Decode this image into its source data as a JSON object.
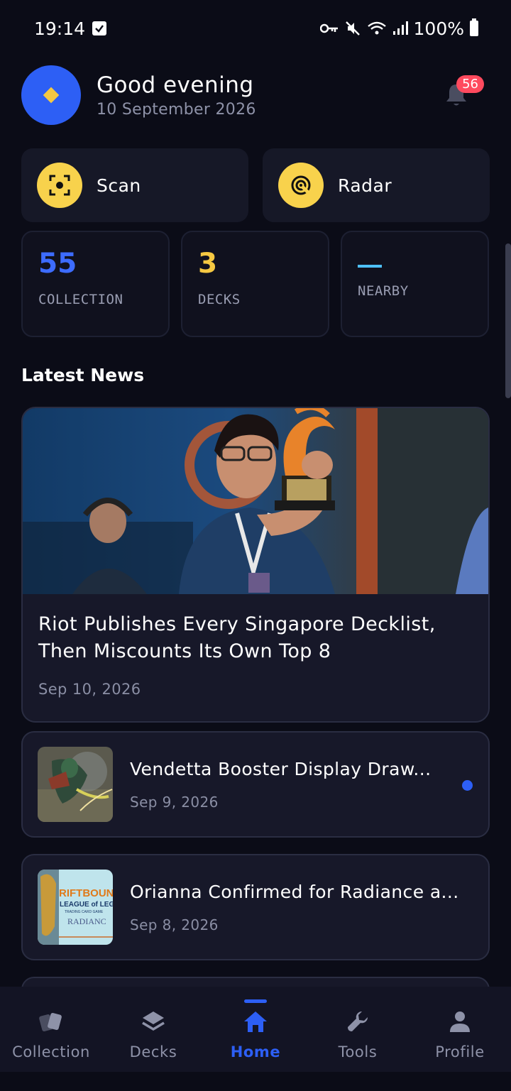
{
  "status_bar": {
    "time": "19:14",
    "battery": "100%"
  },
  "header": {
    "greeting": "Good evening",
    "date": "10 September 2026",
    "notification_count": "56"
  },
  "actions": [
    {
      "label": "Scan",
      "icon": "scan-icon"
    },
    {
      "label": "Radar",
      "icon": "radar-icon"
    }
  ],
  "stats": [
    {
      "value": "55",
      "label": "COLLECTION",
      "color": "#3d6cff"
    },
    {
      "value": "3",
      "label": "DECKS",
      "color": "#f5c842"
    },
    {
      "value": "",
      "label": "NEARBY",
      "color": "#4ec0ff"
    }
  ],
  "news": {
    "section_title": "Latest News",
    "featured": {
      "title": "Riot Publishes Every Singapore Decklist, Then Miscounts Its Own Top 8",
      "date": "Sep 10, 2026"
    },
    "items": [
      {
        "title": "Vendetta Booster Display Draw...",
        "date": "Sep 9, 2026",
        "unread": true
      },
      {
        "title": "Orianna Confirmed for Radiance a...",
        "date": "Sep 8, 2026",
        "unread": false
      }
    ],
    "thumb_logo_text": [
      "RIFTBOUN",
      "LEAGUE of LEGEN",
      "TRADING CARD GAME",
      "RADIANC"
    ]
  },
  "nav": {
    "items": [
      {
        "label": "Collection",
        "icon": "cards-icon"
      },
      {
        "label": "Decks",
        "icon": "layers-icon"
      },
      {
        "label": "Home",
        "icon": "home-icon",
        "active": true
      },
      {
        "label": "Tools",
        "icon": "wrench-icon"
      },
      {
        "label": "Profile",
        "icon": "person-icon"
      }
    ]
  }
}
